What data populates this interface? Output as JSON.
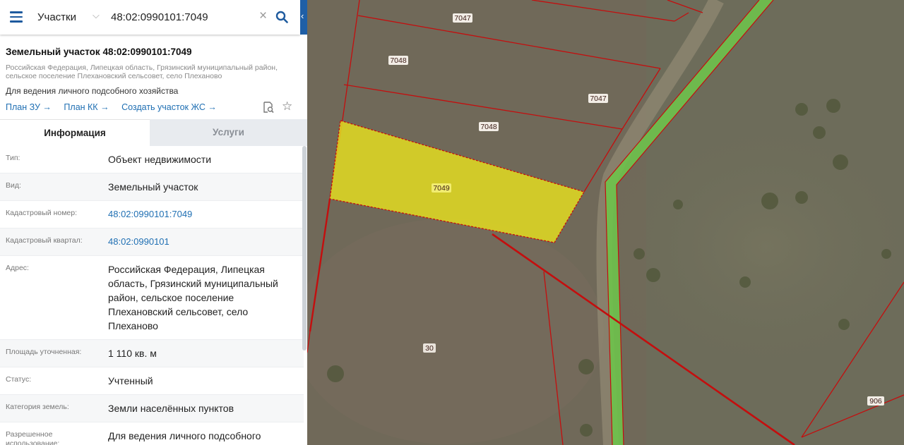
{
  "search": {
    "category": "Участки",
    "query": "48:02:0990101:7049"
  },
  "object": {
    "title": "Земельный участок 48:02:0990101:7049",
    "address_line": "Российская Федерация, Липецкая область, Грязинский муниципальный район, сельское поселение Плехановский сельсовет, село Плеханово",
    "purpose": "Для ведения личного подсобного хозяйства"
  },
  "links": [
    "План ЗУ →",
    "План КК →",
    "Создать участок ЖС →"
  ],
  "tabs": {
    "info": "Информация",
    "services": "Услуги"
  },
  "info_rows": [
    {
      "label": "Тип:",
      "value": "Объект недвижимости"
    },
    {
      "label": "Вид:",
      "value": "Земельный участок"
    },
    {
      "label": "Кадастровый номер:",
      "value": "48:02:0990101:7049"
    },
    {
      "label": "Кадастровый квартал:",
      "value": "48:02:0990101"
    },
    {
      "label": "Адрес:",
      "value": "Российская Федерация, Липецкая область, Грязинский муниципальный район, сельское поселение Плехановский сельсовет, село Плеханово"
    },
    {
      "label": "Площадь уточненная:",
      "value": "1 110 кв. м"
    },
    {
      "label": "Статус:",
      "value": "Учтенный"
    },
    {
      "label": "Категория земель:",
      "value": "Земли населённых пунктов"
    },
    {
      "label": "Разрешенное использование:",
      "value": "Для ведения личного подсобного хозяйства"
    }
  ],
  "map_labels": {
    "p7047_top": "7047",
    "p7048_left": "7048",
    "p7047_right": "7047",
    "p7048_mid": "7048",
    "p7049": "7049",
    "p30": "30",
    "p906": "906"
  },
  "colors": {
    "accent": "#1f5fa6",
    "link": "#1f6fb3",
    "selected_parcel": "#e6df1e",
    "boundary": "#c40e0e",
    "road": "#6ec24b"
  },
  "icons": [
    "menu-icon",
    "chevron-down-icon",
    "close-icon",
    "search-icon",
    "chevron-left-icon",
    "document-search-icon",
    "star-icon"
  ]
}
